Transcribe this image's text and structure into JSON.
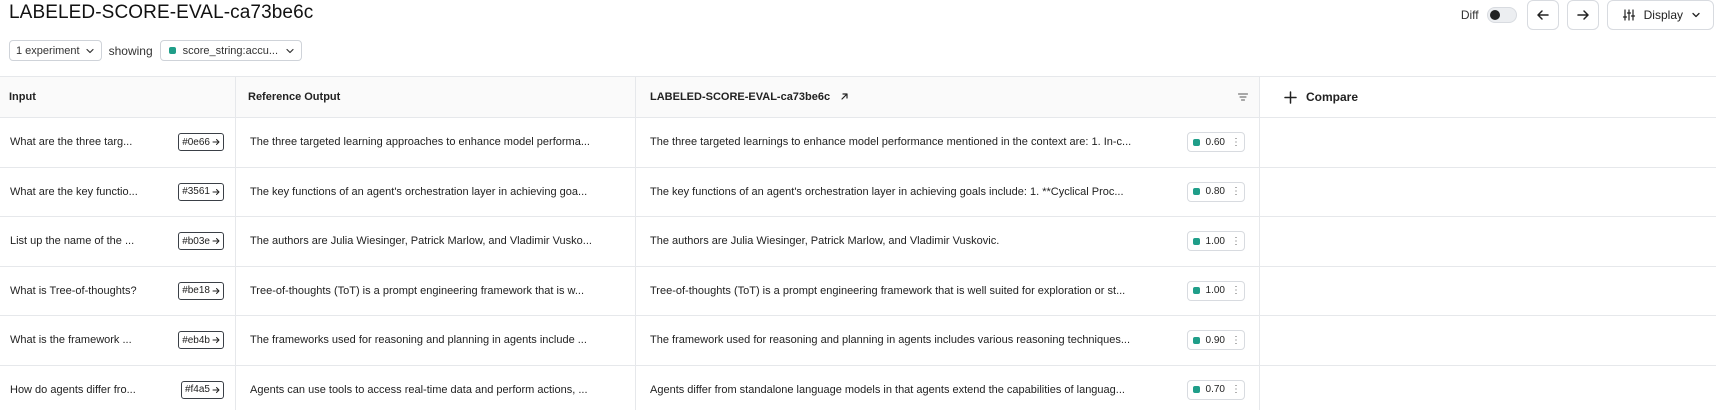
{
  "page": {
    "title": "LABELED-SCORE-EVAL-ca73be6c"
  },
  "toolbar": {
    "diff_label": "Diff",
    "display_label": "Display"
  },
  "filters": {
    "experiment_select": "1 experiment",
    "showing_label": "showing",
    "metric_select": "score_string:accu..."
  },
  "table": {
    "headers": {
      "input": "Input",
      "reference": "Reference Output",
      "run": "LABELED-SCORE-EVAL-ca73be6c",
      "compare": "Compare"
    },
    "rows": [
      {
        "input": "What are the three targ...",
        "id": "#0e66",
        "reference": "The three targeted learning approaches to enhance model performa...",
        "output": "The three targeted learnings to enhance model performance mentioned in the context are: 1. In-c...",
        "score": "0.60"
      },
      {
        "input": "What are the key functio...",
        "id": "#3561",
        "reference": "The key functions of an agent's orchestration layer in achieving goa...",
        "output": "The key functions of an agent's orchestration layer in achieving goals include: 1. **Cyclical Proc...",
        "score": "0.80"
      },
      {
        "input": "List up the name of the ...",
        "id": "#b03e",
        "reference": "The authors are Julia Wiesinger, Patrick Marlow, and Vladimir Vusko...",
        "output": "The authors are Julia Wiesinger, Patrick Marlow, and Vladimir Vuskovic.",
        "score": "1.00"
      },
      {
        "input": "What is Tree-of-thoughts?",
        "id": "#be18",
        "reference": "Tree-of-thoughts (ToT) is a prompt engineering framework that is w...",
        "output": "Tree-of-thoughts (ToT) is a prompt engineering framework that is well suited for exploration or st...",
        "score": "1.00"
      },
      {
        "input": "What is the framework ...",
        "id": "#eb4b",
        "reference": "The frameworks used for reasoning and planning in agents include ...",
        "output": "The framework used for reasoning and planning in agents includes various reasoning techniques...",
        "score": "0.90"
      },
      {
        "input": "How do agents differ fro...",
        "id": "#f4a5",
        "reference": "Agents can use tools to access real-time data and perform actions, ...",
        "output": "Agents differ from standalone language models in that agents extend the capabilities of languag...",
        "score": "0.70"
      }
    ]
  },
  "colors": {
    "score_dot": "#1f9e89",
    "border": "#e6e8eb"
  },
  "icons": {
    "back": "arrow-left-icon",
    "forward": "arrow-right-icon",
    "display": "sliders-icon",
    "open": "external-link-icon",
    "filter": "filter-lines-icon",
    "add": "plus-icon"
  }
}
